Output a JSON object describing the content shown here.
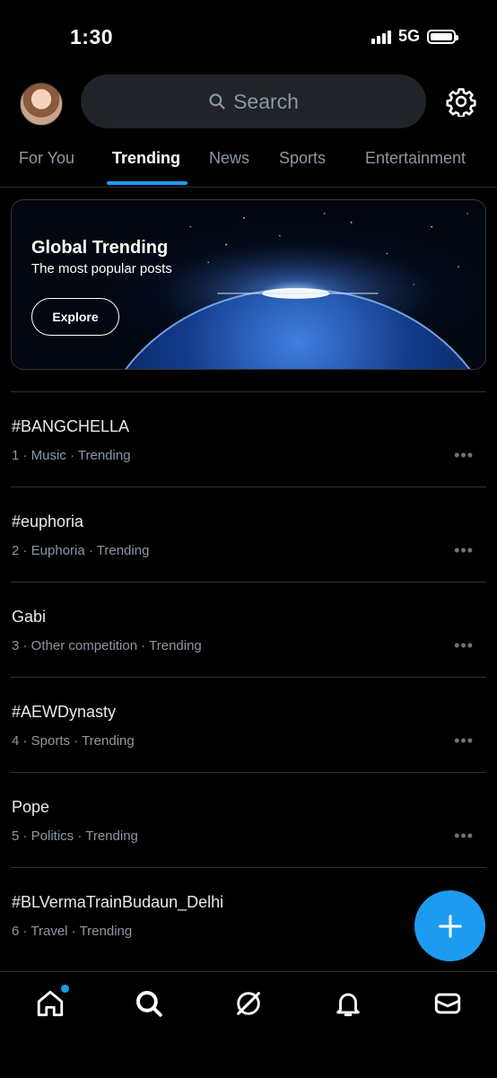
{
  "status_bar": {
    "time": "1:30",
    "network": "5G"
  },
  "search": {
    "placeholder": "Search"
  },
  "tabs": [
    {
      "label": "For You"
    },
    {
      "label": "Trending"
    },
    {
      "label": "News"
    },
    {
      "label": "Sports"
    },
    {
      "label": "Entertainment"
    }
  ],
  "banner": {
    "title": "Global Trending",
    "subtitle": "The most popular posts",
    "button": "Explore"
  },
  "trends": [
    {
      "title": "#BANGCHELLA",
      "meta": "1 · Music · Trending"
    },
    {
      "title": "#euphoria",
      "meta": "2 · Euphoria · Trending"
    },
    {
      "title": "Gabi",
      "meta": "3 · Other competition · Trending"
    },
    {
      "title": "#AEWDynasty",
      "meta": "4 · Sports · Trending"
    },
    {
      "title": "Pope",
      "meta": "5 · Politics · Trending"
    },
    {
      "title": "#BLVermaTrainBudaun_Delhi",
      "meta": "6 · Travel · Trending"
    }
  ],
  "icons": {
    "more": "•••",
    "settings": "gear-icon",
    "compose": "plus-icon",
    "nav": [
      "home-icon",
      "search-icon",
      "grok-icon",
      "bell-icon",
      "mail-icon"
    ]
  },
  "colors": {
    "accent": "#1d9bf0",
    "background": "#000000",
    "muted": "#8b98a5"
  }
}
